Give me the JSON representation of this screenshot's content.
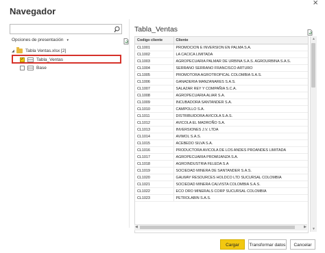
{
  "window": {
    "title": "Navegador",
    "close_glyph": "×"
  },
  "search": {
    "placeholder": "",
    "icon": "search-icon"
  },
  "left_panel": {
    "options_label": "Opciones de presentación",
    "options_chevron": "▾",
    "tree": {
      "file": {
        "label": "Tabla Ventas.xlsx [2]",
        "expanded": true
      },
      "items": [
        {
          "label": "Tabla_Ventas",
          "checked": true,
          "highlighted": true
        },
        {
          "label": "Base",
          "checked": false,
          "highlighted": false
        }
      ]
    }
  },
  "preview": {
    "title": "Tabla_Ventas",
    "columns": [
      "Codigo cliente",
      "Cliente"
    ],
    "rows": [
      [
        "CL1001",
        "PROMOCION E INVERSION EN PALMA S.A."
      ],
      [
        "CL1002",
        "LA CACICA LIMITADA"
      ],
      [
        "CL1003",
        "AGROPECUARIA PALMAR DE URBINA S.A.S. AGROURBINA S.A.S."
      ],
      [
        "CL1004",
        "SERRANO SERRANO FRANCISCO ARTURO"
      ],
      [
        "CL1005",
        "PROMOTORA AGROTROPICAL COLOMBIA S.A.S."
      ],
      [
        "CL1006",
        "GANADERIA MANZANARES S.A.S."
      ],
      [
        "CL1007",
        "SALAZAR REY Y COMPAÑIA S.C.A."
      ],
      [
        "CL1008",
        "AGROPECUARIA ALIAR S.A."
      ],
      [
        "CL1009",
        "INCUBADORA SANTANDER S.A."
      ],
      [
        "CL1010",
        "CAMPOLLO S.A."
      ],
      [
        "CL1011",
        "DISTRIBUIDORA AVICOLA S.A.S."
      ],
      [
        "CL1012",
        "AVICOLA EL MADROÑO S.A."
      ],
      [
        "CL1013",
        "INVERSIONES J.V. LTDA"
      ],
      [
        "CL1014",
        "AVIMOL S.A.S."
      ],
      [
        "CL1015",
        "ACEBEDO SILVA S.A."
      ],
      [
        "CL1016",
        "PRODUCTORA AVICOLA DE LOS ANDES PROANDES LIMITADA"
      ],
      [
        "CL1017",
        "AGROPECUARIA PROMIJANZA S.A."
      ],
      [
        "CL1018",
        "AGROINDUSTRIA FELEDA S.A"
      ],
      [
        "CL1019",
        "SOCIEDAD MINERA DE SANTANDER S.A.S."
      ],
      [
        "CL1020",
        "GALWAY RESOURCES HOLDCO LTD SUCURSAL COLOMBIA"
      ],
      [
        "CL1021",
        "SOCIEDAD MINERA CALVISTA COLOMBIA S.A.S."
      ],
      [
        "CL1022",
        "ECO ORO MINERALS CORP SUCURSAL COLOMBIA"
      ],
      [
        "CL1023",
        "PETROLABIN S.A.S."
      ]
    ]
  },
  "buttons": {
    "load": "Cargar",
    "transform": "Transformar datos",
    "cancel": "Cancelar"
  },
  "colors": {
    "accent": "#f2c811",
    "highlight": "#d63028"
  }
}
